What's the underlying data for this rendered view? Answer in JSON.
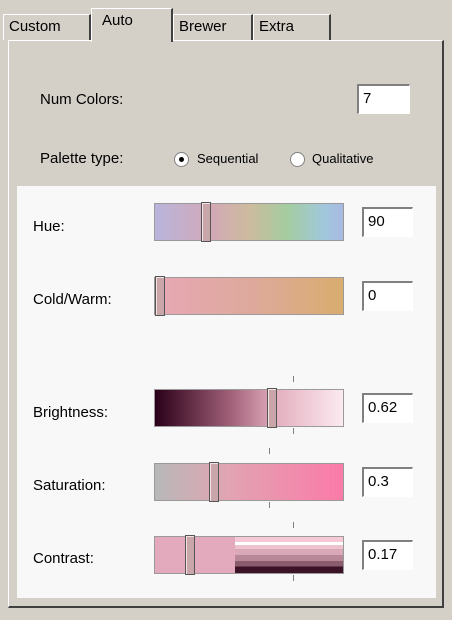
{
  "tabs": [
    {
      "label": "Custom"
    },
    {
      "label": "Auto"
    },
    {
      "label": "Brewer"
    },
    {
      "label": "Extra"
    }
  ],
  "active_tab": "Auto",
  "num_colors": {
    "label": "Num Colors:",
    "value": "7"
  },
  "palette_type": {
    "label": "Palette type:",
    "options": [
      {
        "label": "Sequential",
        "selected": true
      },
      {
        "label": "Qualitative",
        "selected": false
      }
    ]
  },
  "sliders": [
    {
      "label": "Hue:",
      "value": "90",
      "position": 0.27
    },
    {
      "label": "Cold/Warm:",
      "value": "0",
      "position": 0.0
    },
    {
      "label": "Brightness:",
      "value": "0.62",
      "position": 0.62
    },
    {
      "label": "Saturation:",
      "value": "0.3",
      "position": 0.3
    },
    {
      "label": "Contrast:",
      "value": "0.17",
      "position": 0.17
    }
  ]
}
